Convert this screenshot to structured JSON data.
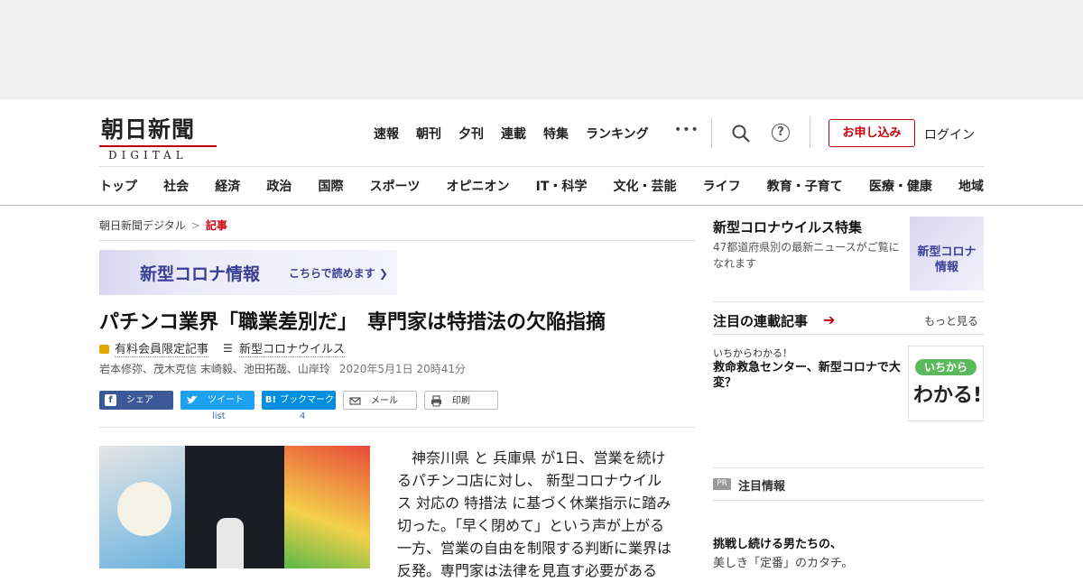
{
  "logo": {
    "main": "朝日新聞",
    "sub": "DIGITAL"
  },
  "topnav": [
    "速報",
    "朝刊",
    "夕刊",
    "連載",
    "特集",
    "ランキング"
  ],
  "topnav_more": "•••",
  "help_glyph": "?",
  "apply_label": "お申し込み",
  "login_label": "ログイン",
  "catnav": [
    "トップ",
    "社会",
    "経済",
    "政治",
    "国際",
    "スポーツ",
    "オピニオン",
    "IT・科学",
    "文化・芸能",
    "ライフ",
    "教育・子育て",
    "医療・健康",
    "地域"
  ],
  "breadcrumb": {
    "home": "朝日新聞デジタル",
    "sep": ">",
    "current": "記事"
  },
  "banner": {
    "title": "新型コロナ情報",
    "sub": "こちらで読めます ❯"
  },
  "article": {
    "title": "パチンコ業界「職業差別だ」　専門家は特措法の欠陥指摘",
    "member": "有料会員限定記事",
    "topic": "新型コロナウイルス",
    "authors": "岩本修弥、茂木克信 末崎毅、池田拓哉、山岸玲",
    "date": "2020年5月1日 20時41分",
    "body": "神奈川県 と 兵庫県 が1日、営業を続けるパチンコ店に対し、 新型コロナウイルス 対応の 特措法 に基づく休業指示に踏み切った。「早く閉めて」という声が上がる一方、営業の自由を制限する判断に業界は反発。専門家は法律を見直す必要がある"
  },
  "share": {
    "facebook": "シェア",
    "twitter": "ツイート",
    "twitter_count": "list",
    "hatena": "ブックマーク",
    "hatena_icon": "B!",
    "hatena_count": "4",
    "mail": "メール",
    "print": "印刷"
  },
  "sidebar": {
    "feature_title": "新型コロナウイルス特集",
    "feature_desc": "47都道府県別の最新ニュースがご覧になれます",
    "feature_thumb": [
      "新型コロナ",
      "情報"
    ],
    "series_title": "注目の連載記事",
    "series_more": "もっと見る",
    "ichi_kicker": "いちからわかる！",
    "ichi_title": "救命救急センター、新型コロナで大変？",
    "wakaru_badge": "いちから",
    "wakaru_text": "わかる!",
    "pr_badge": "PR",
    "pr_title": "注目情報",
    "ad_title": "挑戦し続ける男たちの、",
    "ad_sub": "美しき「定番」のカタチ。"
  }
}
